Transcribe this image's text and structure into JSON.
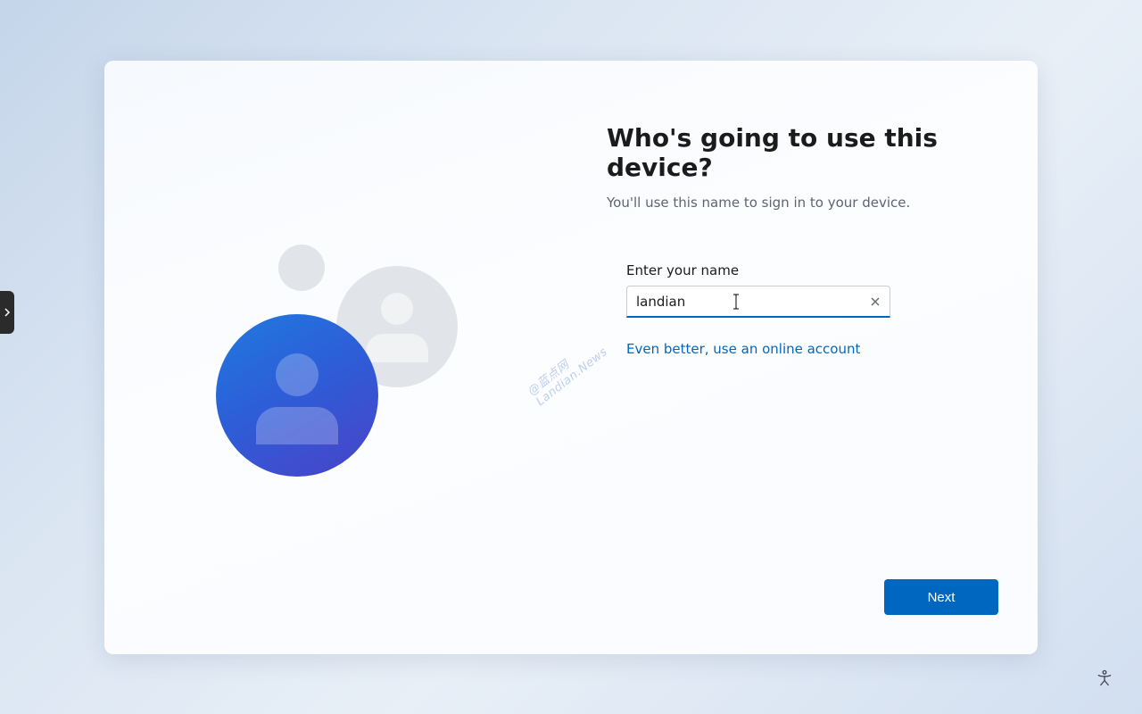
{
  "page": {
    "title": "Who's going to use this device?",
    "subtitle": "You'll use this name to sign in to your device."
  },
  "form": {
    "name_label": "Enter your name",
    "name_value": "landian",
    "online_link": "Even better, use an online account"
  },
  "actions": {
    "next_label": "Next"
  },
  "watermark": "@蓝点网 Landian.News",
  "icons": {
    "clear": "close-icon",
    "accessibility": "accessibility-icon",
    "side_tab": "chevron-right-icon",
    "avatar_small": "avatar-small-icon",
    "avatar_medium": "avatar-medium-icon",
    "avatar_large": "avatar-large-icon"
  },
  "colors": {
    "accent": "#0067c0",
    "avatar_gradient_start": "#1f7ae0",
    "avatar_gradient_end": "#4a42c8"
  }
}
